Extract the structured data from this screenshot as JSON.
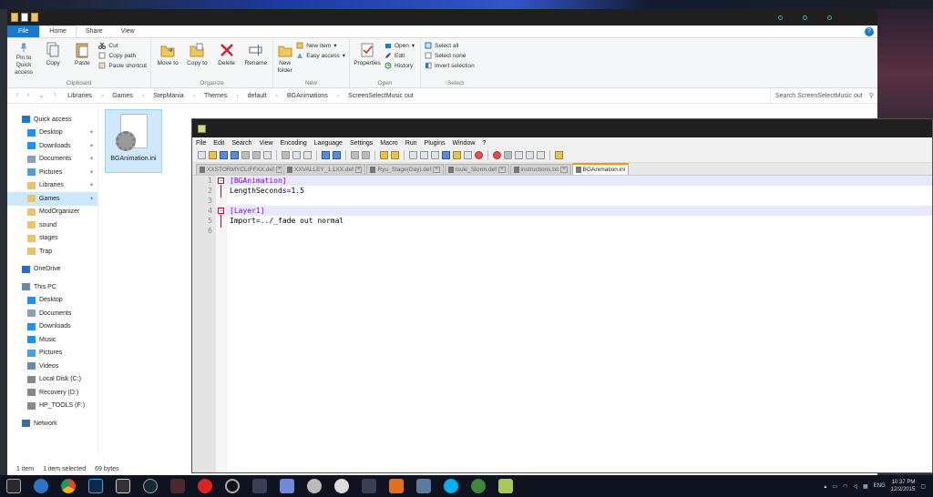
{
  "explorer": {
    "ribbon_tabs": [
      "File",
      "Home",
      "Share",
      "View"
    ],
    "help": "?",
    "groups": {
      "clipboard": {
        "name": "Clipboard",
        "pin": "Pin to Quick access",
        "copy": "Copy",
        "paste": "Paste",
        "cut": "Cut",
        "copy_path": "Copy path",
        "paste_shortcut": "Paste shortcut"
      },
      "organize": {
        "name": "Organize",
        "move_to": "Move to",
        "copy_to": "Copy to",
        "delete": "Delete",
        "rename": "Rename"
      },
      "new": {
        "name": "New",
        "new_folder": "New folder",
        "new_item": "New item",
        "easy_access": "Easy access"
      },
      "open": {
        "name": "Open",
        "properties": "Properties",
        "open": "Open",
        "edit": "Edit",
        "history": "History"
      },
      "select": {
        "name": "Select",
        "select_all": "Select all",
        "select_none": "Select none",
        "invert": "Invert selection"
      }
    },
    "breadcrumbs": [
      "Libraries",
      "Games",
      "StepMania",
      "Themes",
      "default",
      "BGAnimations",
      "ScreenSelectMusic out"
    ],
    "search_placeholder": "Search ScreenSelectMusic out",
    "nav": {
      "quick_access": "Quick access",
      "quick_items": [
        {
          "label": "Desktop",
          "pinned": true
        },
        {
          "label": "Downloads",
          "pinned": true
        },
        {
          "label": "Documents",
          "pinned": true
        },
        {
          "label": "Pictures",
          "pinned": true
        },
        {
          "label": "Libraries",
          "pinned": true
        },
        {
          "label": "Games",
          "pinned": true
        },
        {
          "label": "ModOrganizer",
          "pinned": false
        },
        {
          "label": "sound",
          "pinned": false
        },
        {
          "label": "stages",
          "pinned": false
        },
        {
          "label": "Trap",
          "pinned": false
        }
      ],
      "onedrive": "OneDrive",
      "this_pc": "This PC",
      "pc_items": [
        "Desktop",
        "Documents",
        "Downloads",
        "Music",
        "Pictures",
        "Videos",
        "Local Disk (C:)",
        "Recovery (D:)",
        "HP_TOOLS (F:)"
      ],
      "network": "Network"
    },
    "file": {
      "name": "BGAnimation.ini"
    },
    "status": {
      "count": "1 item",
      "selected": "1 item selected",
      "size": "69 bytes"
    }
  },
  "npp": {
    "menu": [
      "File",
      "Edit",
      "Search",
      "View",
      "Encoding",
      "Language",
      "Settings",
      "Macro",
      "Run",
      "Plugins",
      "Window",
      "?"
    ],
    "tabs": [
      {
        "label": "XXSTORMYCLIFFXX.def",
        "active": false
      },
      {
        "label": "XXVALLEY_1.1XX.def",
        "active": false
      },
      {
        "label": "Ryu_Stage(Day).def",
        "active": false
      },
      {
        "label": "tsuki_Storm.def",
        "active": false
      },
      {
        "label": "instructions.txt",
        "active": false
      },
      {
        "label": "BGAnimation.ini",
        "active": true
      }
    ],
    "line_numbers": [
      "1",
      "2",
      "3",
      "4",
      "5",
      "6"
    ],
    "lines": [
      {
        "section": "[BGAnimation]"
      },
      {
        "key": "LengthSeconds",
        "eq": "=",
        "value": "1.5"
      },
      {},
      {
        "section": "[Layer1]"
      },
      {
        "key": "Import",
        "eq": "=",
        "value": "../_fade out normal"
      },
      {}
    ]
  },
  "taskbar": {
    "lang": "ENG",
    "time": "10:37 PM",
    "date": "12/2/2015"
  },
  "colors": {
    "accent": "#1979ca",
    "selection": "#cce8ff",
    "section": "#8000ff",
    "active_tab": "#f59b00"
  }
}
